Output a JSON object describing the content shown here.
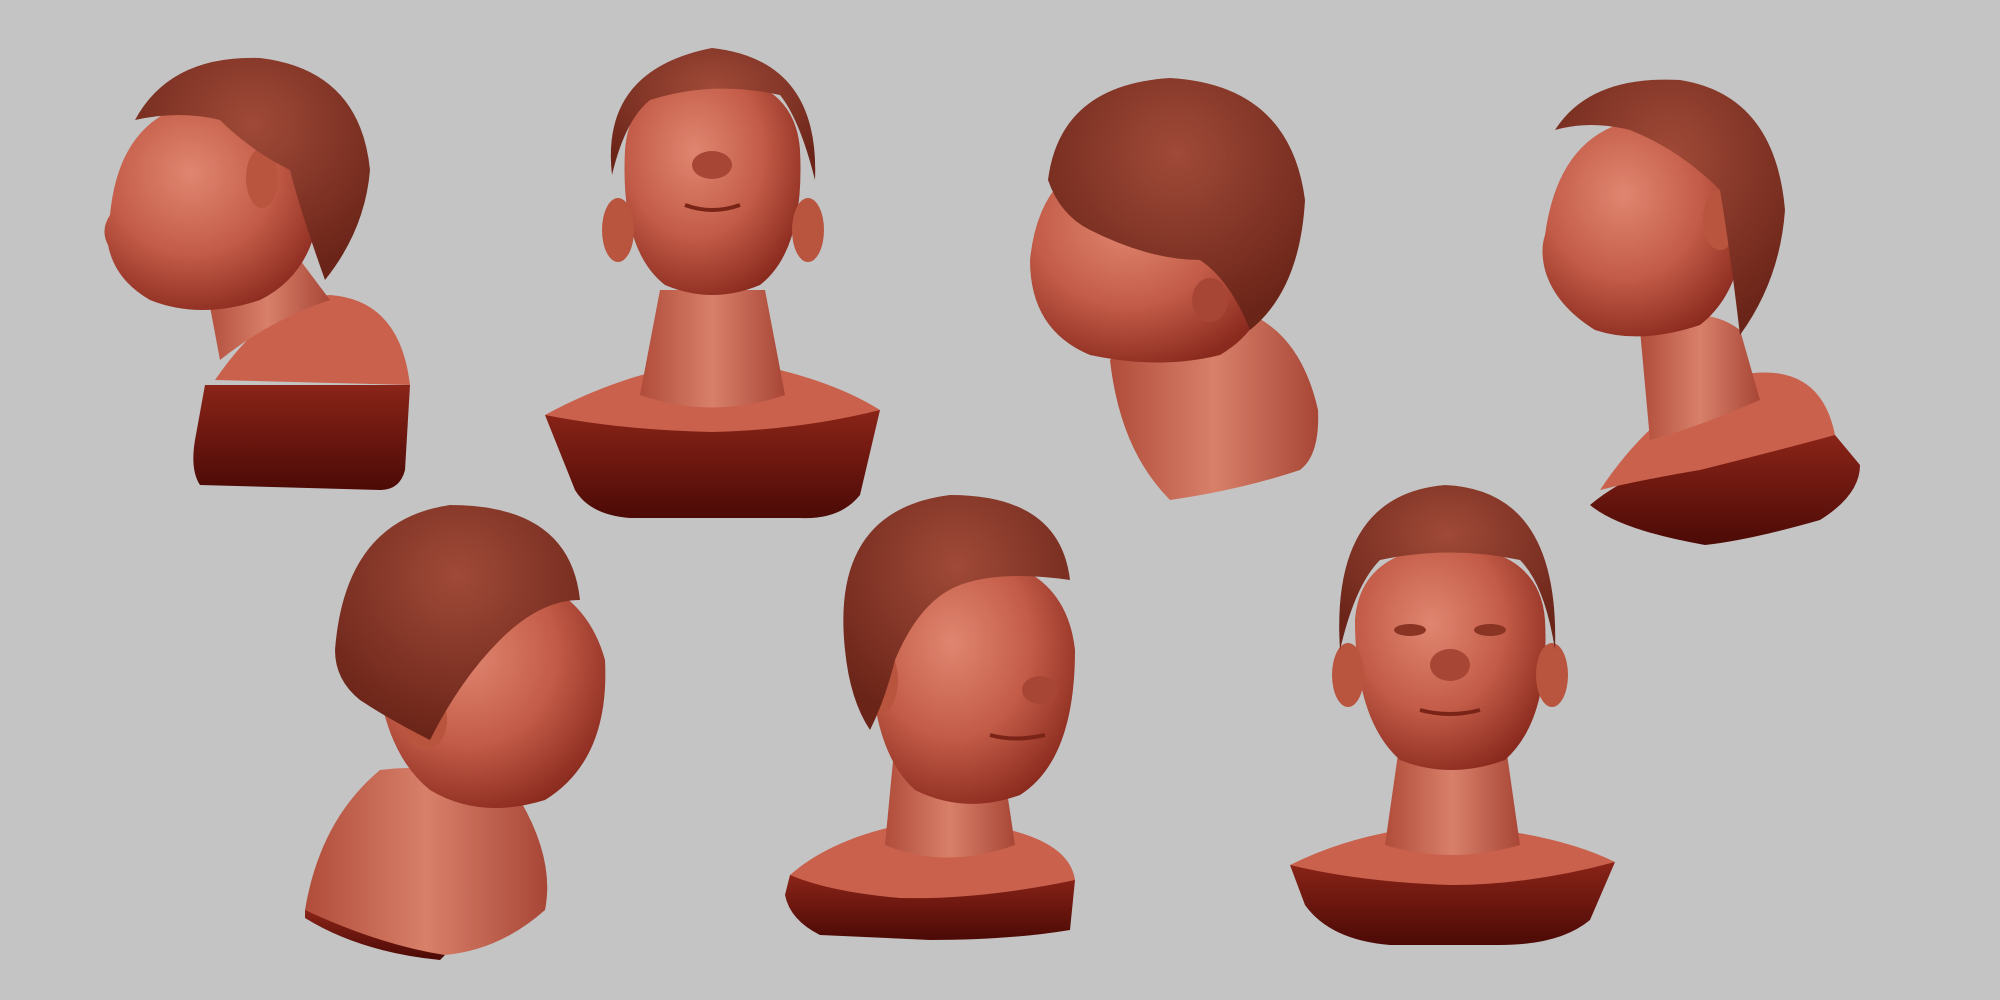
{
  "scene": {
    "background_color": "#c4c4c4",
    "skin_light": "#d4735f",
    "skin_mid": "#b5513f",
    "skin_dark": "#5c0f0a",
    "hair_color": "#8a3a2c",
    "hair_dark": "#5a1c14",
    "base_color": "#6b1510",
    "base_top_color": "#c9614d"
  },
  "busts": [
    {
      "view": "left-profile-tilted-up"
    },
    {
      "view": "front-tilted-up"
    },
    {
      "view": "three-quarter-left-looking-down"
    },
    {
      "view": "three-quarter-left-tilted-up"
    },
    {
      "view": "three-quarter-right-looking-down"
    },
    {
      "view": "three-quarter-right"
    },
    {
      "view": "front"
    }
  ]
}
